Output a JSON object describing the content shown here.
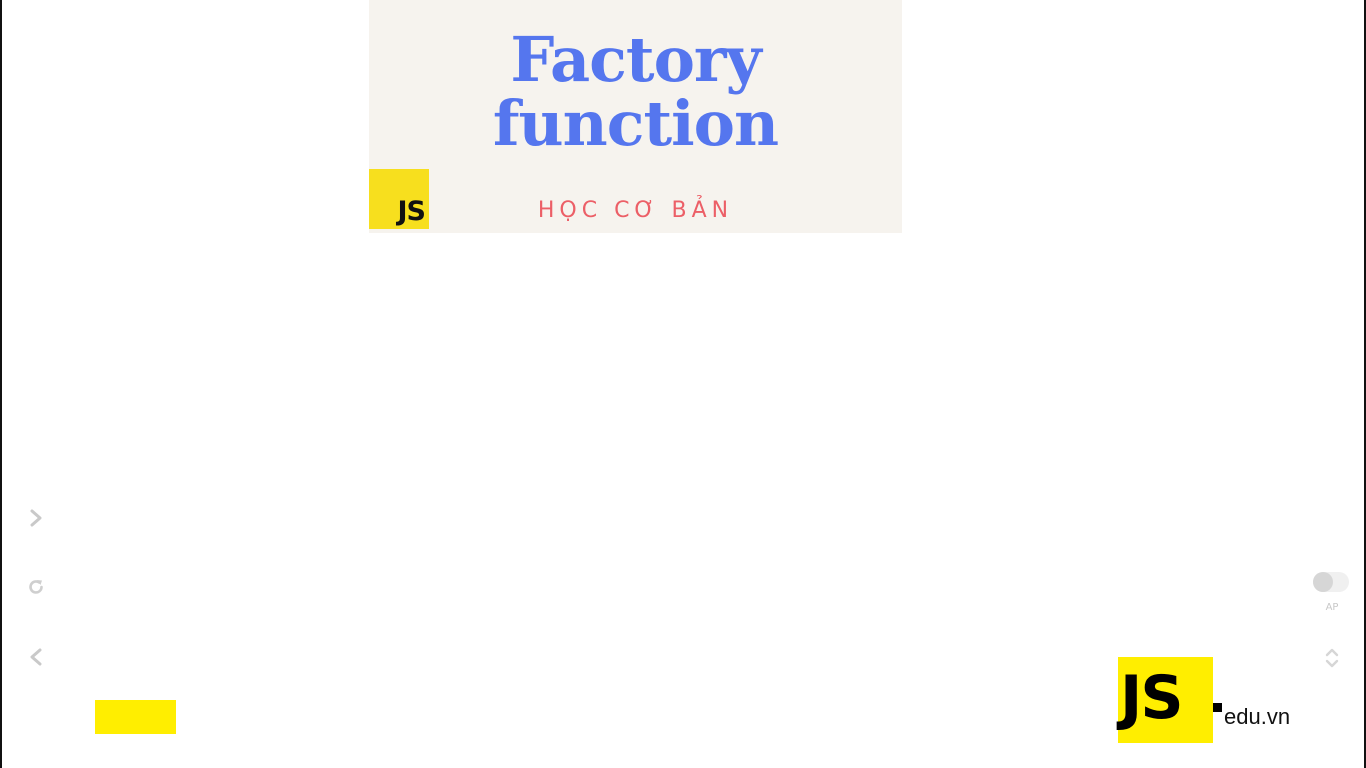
{
  "banner": {
    "title_line1": "Factory",
    "title_line2": "function",
    "subtitle": "HỌC CƠ BẢN",
    "badge": "JS",
    "colors": {
      "background": "#f6f3ee",
      "title": "#5576ee",
      "subtitle": "#ec5f67",
      "badge": "#f7df1e"
    }
  },
  "player": {
    "controls": {
      "next_icon": "chevron-right-icon",
      "replay_icon": "replay-icon",
      "prev_icon": "chevron-left-icon"
    },
    "autoplay": {
      "label": "AP",
      "enabled": false
    },
    "expand_icon": "chevrons-up-down-icon"
  },
  "watermark": {
    "brand": "JS",
    "domain": "edu.vn",
    "color": "#ffee00"
  }
}
